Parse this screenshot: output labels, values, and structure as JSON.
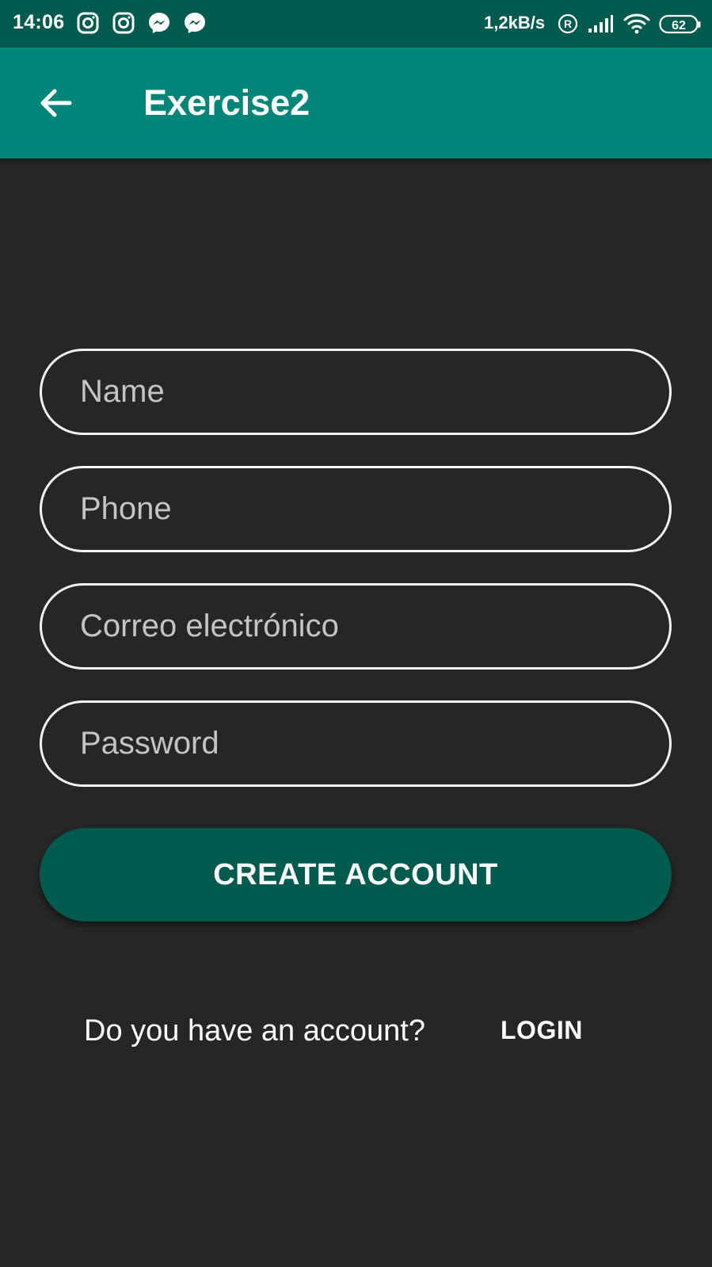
{
  "status_bar": {
    "time": "14:06",
    "net_speed": "1,2kB/s",
    "battery": "62",
    "icons": [
      "instagram-icon",
      "instagram-icon",
      "messenger-icon",
      "messenger-icon",
      "roaming-icon",
      "signal-icon",
      "wifi-icon",
      "battery-icon"
    ]
  },
  "app_bar": {
    "title": "Exercise2",
    "back_icon": "arrow-back-icon"
  },
  "form": {
    "name_placeholder": "Name",
    "phone_placeholder": "Phone",
    "email_placeholder": "Correo electrónico",
    "password_placeholder": "Password",
    "create_button": "CREATE ACCOUNT"
  },
  "footer": {
    "question": "Do you have an account?",
    "login": "LOGIN"
  },
  "colors": {
    "status_bar": "#005a4e",
    "app_bar": "#008577",
    "background": "#262626",
    "button": "#005a4e"
  }
}
